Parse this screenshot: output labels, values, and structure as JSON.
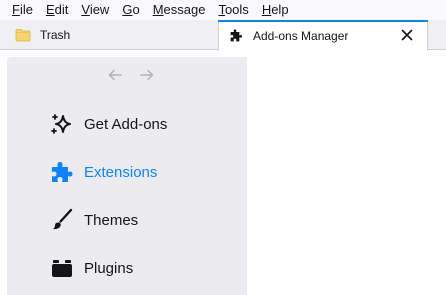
{
  "menubar": {
    "items": [
      {
        "accel": "F",
        "rest": "ile"
      },
      {
        "accel": "E",
        "rest": "dit"
      },
      {
        "accel": "V",
        "rest": "iew"
      },
      {
        "accel": "G",
        "rest": "o"
      },
      {
        "accel": "M",
        "rest": "essage"
      },
      {
        "accel": "T",
        "rest": "ools"
      },
      {
        "accel": "H",
        "rest": "elp"
      }
    ]
  },
  "tabs": {
    "trash": {
      "label": "Trash",
      "icon": "folder-icon"
    },
    "addons": {
      "label": "Add-ons Manager",
      "icon": "puzzle-icon",
      "close_icon": "close-icon"
    }
  },
  "sidebar": {
    "nav": {
      "back_icon": "back-arrow-icon",
      "forward_icon": "forward-arrow-icon"
    },
    "categories": [
      {
        "label": "Get Add-ons",
        "icon": "sparkle-icon"
      },
      {
        "label": "Extensions",
        "icon": "puzzle-icon",
        "selected": true
      },
      {
        "label": "Themes",
        "icon": "brush-icon"
      },
      {
        "label": "Plugins",
        "icon": "plugin-icon"
      }
    ]
  },
  "colors": {
    "accent": "#0a84ff",
    "sidebar_bg": "#ececf0",
    "tabbar_bg": "#f0f0f4",
    "text": "#15141a"
  }
}
